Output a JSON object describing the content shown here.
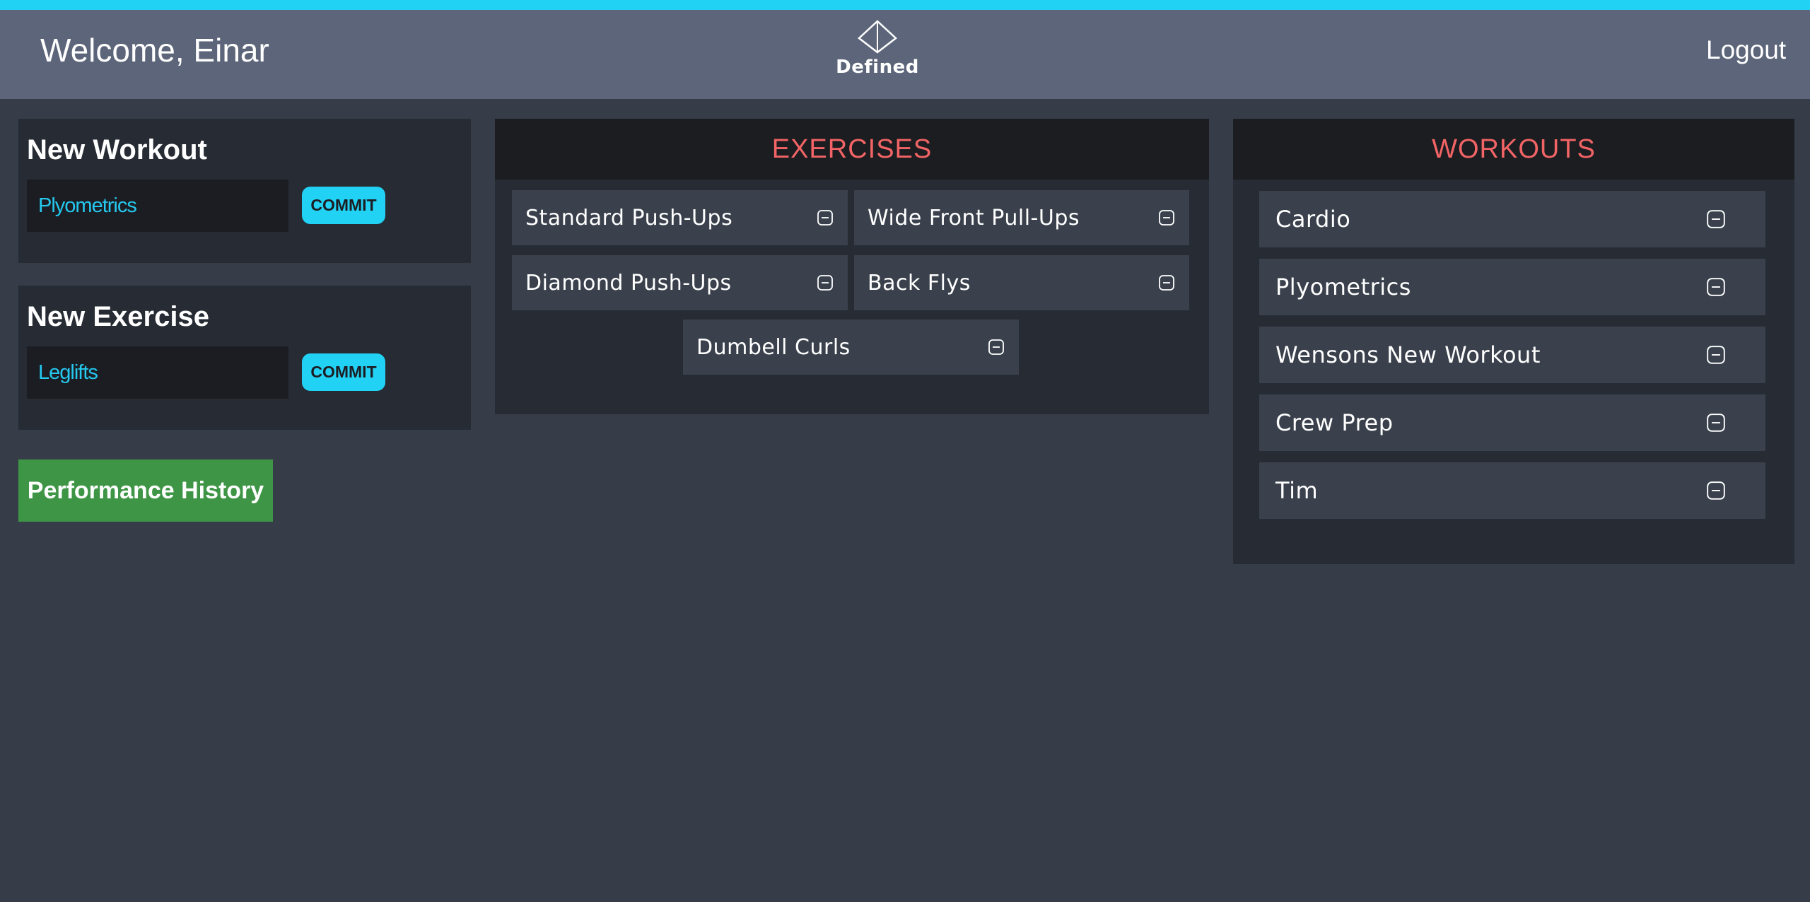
{
  "header": {
    "welcome": "Welcome, Einar",
    "logo_text": "Defined",
    "logout_label": "Logout"
  },
  "new_workout": {
    "title": "New Workout",
    "input_value": "Plyometrics",
    "commit_label": "COMMIT"
  },
  "new_exercise": {
    "title": "New Exercise",
    "input_value": "Leglifts",
    "commit_label": "COMMIT"
  },
  "performance_history_label": "Performance History",
  "exercises": {
    "title": "EXERCISES",
    "items": [
      {
        "label": "Standard Push-Ups"
      },
      {
        "label": "Wide Front Pull-Ups"
      },
      {
        "label": "Diamond Push-Ups"
      },
      {
        "label": "Back Flys"
      },
      {
        "label": "Dumbell Curls"
      }
    ]
  },
  "workouts": {
    "title": "WORKOUTS",
    "items": [
      {
        "label": "Cardio"
      },
      {
        "label": "Plyometrics"
      },
      {
        "label": "Wensons New Workout"
      },
      {
        "label": "Crew Prep"
      },
      {
        "label": "Tim"
      }
    ]
  },
  "icons": {
    "logo": "diamond-logo-icon",
    "remove": "minus-square-icon"
  },
  "colors": {
    "accent": "#22d2f5",
    "header_bg": "#5c6579",
    "section_title": "#f26465",
    "success": "#3e9545"
  }
}
